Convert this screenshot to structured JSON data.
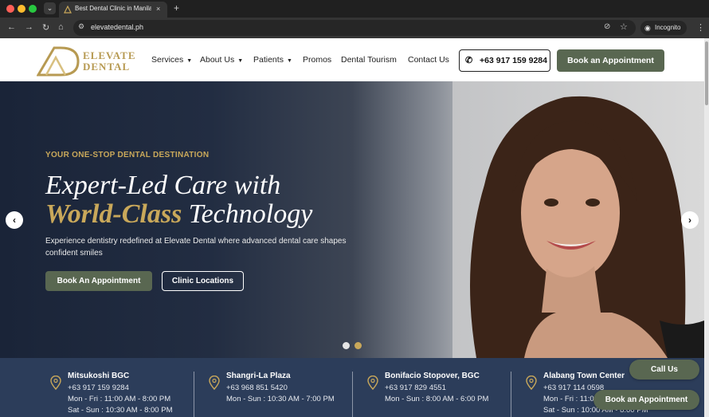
{
  "browser": {
    "tab_title": "Best Dental Clinic in Manila | E",
    "tab_close": "×",
    "new_tab": "+",
    "url": "elevatedental.ph",
    "incognito_label": "Incognito"
  },
  "header": {
    "logo_line1": "ELEVATE",
    "logo_line2": "DENTAL",
    "nav": [
      {
        "label": "Services",
        "caret": "▼"
      },
      {
        "label": "About Us",
        "caret": "▼"
      },
      {
        "label": "Patients",
        "caret": "▼"
      },
      {
        "label": "Promos",
        "caret": ""
      },
      {
        "label": "Dental Tourism",
        "caret": ""
      },
      {
        "label": "Contact Us",
        "caret": ""
      }
    ],
    "phone": "+63 917 159 9284",
    "book_label": "Book an Appointment"
  },
  "hero": {
    "eyebrow": "YOUR ONE-STOP DENTAL DESTINATION",
    "heading_line1": "Expert-Led Care with",
    "heading_gold": "World-Class",
    "heading_line2_rest": " Technology",
    "subtitle": "Experience dentistry redefined at Elevate Dental where advanced dental care shapes confident smiles",
    "book_label": "Book An Appointment",
    "locations_label": "Clinic Locations",
    "prev_arrow": "‹",
    "next_arrow": "›",
    "slide_count": 2,
    "active_slide": 2
  },
  "locations": [
    {
      "name": "Mitsukoshi BGC",
      "phone": "+63 917 159 9284",
      "hours1": "Mon - Fri : 11:00 AM - 8:00 PM",
      "hours2": "Sat - Sun : 10:30 AM - 8:00 PM"
    },
    {
      "name": "Shangri-La Plaza",
      "phone": "+63 968 851 5420",
      "hours1": "Mon - Sun : 10:30 AM - 7:00 PM",
      "hours2": ""
    },
    {
      "name": "Bonifacio Stopover, BGC",
      "phone": "+63 917 829 4551",
      "hours1": "Mon - Sun : 8:00 AM - 6:00 PM",
      "hours2": ""
    },
    {
      "name": "Alabang Town Center",
      "phone": "+63 917 114 0598",
      "hours1": "Mon - Fri : 11:00 AM - 8:00 PM",
      "hours2": "Sat - Sun : 10:00 AM - 8:00 PM"
    }
  ],
  "floating": {
    "call_label": "Call Us",
    "book_label": "Book an Appointment"
  },
  "colors": {
    "accent_green": "#596751",
    "gold": "#c9a85a",
    "navy": "#2c3d5a"
  }
}
